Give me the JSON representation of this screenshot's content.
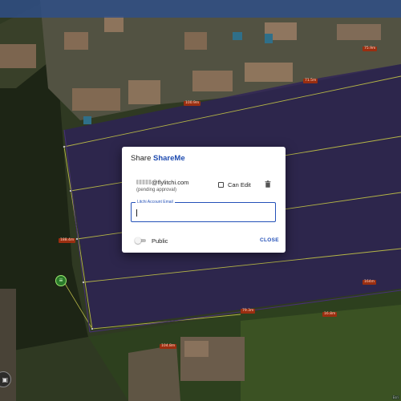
{
  "dialog": {
    "title_prefix": "Share",
    "project_name": "ShareMe",
    "shared_user": {
      "email_suffix": "@flylitchi.com",
      "status": "(pending approval)",
      "can_edit_label": "Can Edit",
      "can_edit_checked": false
    },
    "email_field": {
      "label": "Litchi Account Email",
      "value": ""
    },
    "public_label": "Public",
    "public_enabled": false,
    "close_label": "CLOSE"
  },
  "map": {
    "distance_labels": [
      "75.9m",
      "71.5m",
      "100.9m",
      "188.4m",
      "79.3m",
      "16.8m",
      "164m",
      "104.8m"
    ],
    "attribution": "Esri",
    "colors": {
      "field_overlay": "#3a2a72",
      "boundary_line": "#e8e85a",
      "label_bg": "#9a2e10",
      "accent": "#2451b8"
    }
  }
}
